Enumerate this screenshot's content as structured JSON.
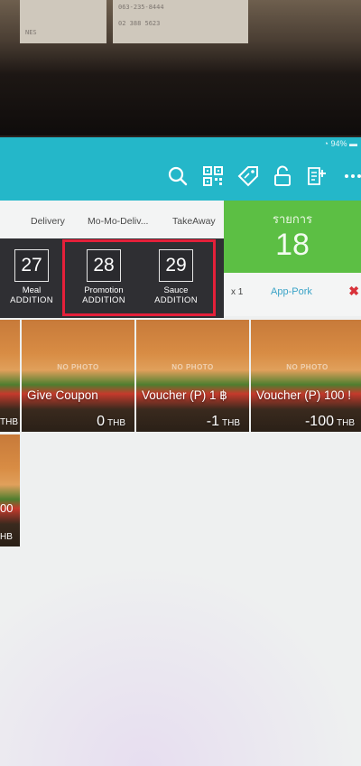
{
  "background_paper": {
    "left_lines": [
      "NES"
    ],
    "right_lines": [
      "063-235-8444",
      "02 388 5623"
    ]
  },
  "status_bar": {
    "battery": "94%"
  },
  "header": {
    "icons": [
      "search-icon",
      "qr-code-icon",
      "tag-discount-icon",
      "unlock-icon",
      "add-note-icon",
      "more-icon"
    ],
    "accent_color": "#24b7c9"
  },
  "tabs": [
    "Delivery",
    "Mo-Mo-Deliv...",
    "TakeAway"
  ],
  "order_panel": {
    "label": "รายการ",
    "count": "18",
    "line": {
      "qty": "x 1",
      "item": "App-Pork",
      "remove": "✖"
    }
  },
  "categories": [
    {
      "number": "27",
      "name": "Meal",
      "type": "ADDITION"
    },
    {
      "number": "28",
      "name": "Promotion",
      "type": "ADDITION"
    },
    {
      "number": "29",
      "name": "Sauce",
      "type": "ADDITION"
    }
  ],
  "products": [
    {
      "name": "",
      "price": "",
      "currency": "THB"
    },
    {
      "name": "Give Coupon",
      "price": "0",
      "currency": "THB",
      "placeholder": "NO PHOTO"
    },
    {
      "name": "Voucher (P) 1 ฿",
      "price": "-1",
      "currency": "THB",
      "placeholder": "NO PHOTO"
    },
    {
      "name": "Voucher (P) 100 !",
      "price": "-100",
      "currency": "THB",
      "placeholder": "NO PHOTO"
    },
    {
      "name": "",
      "price": "00",
      "currency": "HB"
    }
  ]
}
